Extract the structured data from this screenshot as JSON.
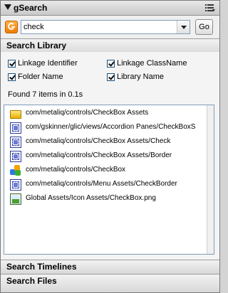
{
  "panel": {
    "title": "gSearch"
  },
  "search": {
    "query": "check",
    "go_label": "Go"
  },
  "library": {
    "header": "Search Library",
    "options": [
      {
        "label": "Linkage Identifier",
        "checked": true
      },
      {
        "label": "Linkage ClassName",
        "checked": true
      },
      {
        "label": "Folder Name",
        "checked": true
      },
      {
        "label": "Library Name",
        "checked": true
      }
    ],
    "status": "Found 7 items in 0.1s",
    "results": [
      {
        "icon": "folder-icon",
        "text": "com/metaliq/controls/CheckBox Assets"
      },
      {
        "icon": "movieclip-symbol-icon",
        "text": "com/gskinner/glic/views/Accordion Panes/CheckBoxS"
      },
      {
        "icon": "movieclip-symbol-icon",
        "text": "com/metaliq/controls/CheckBox Assets/Check"
      },
      {
        "icon": "movieclip-symbol-icon",
        "text": "com/metaliq/controls/CheckBox Assets/Border"
      },
      {
        "icon": "component-icon",
        "text": "com/metaliq/controls/CheckBox"
      },
      {
        "icon": "movieclip-symbol-icon",
        "text": "com/metaliq/controls/Menu Assets/CheckBorder"
      },
      {
        "icon": "bitmap-icon",
        "text": "Global Assets/Icon Assets/CheckBox.png"
      }
    ]
  },
  "sections": {
    "timelines": "Search Timelines",
    "files": "Search Files"
  }
}
